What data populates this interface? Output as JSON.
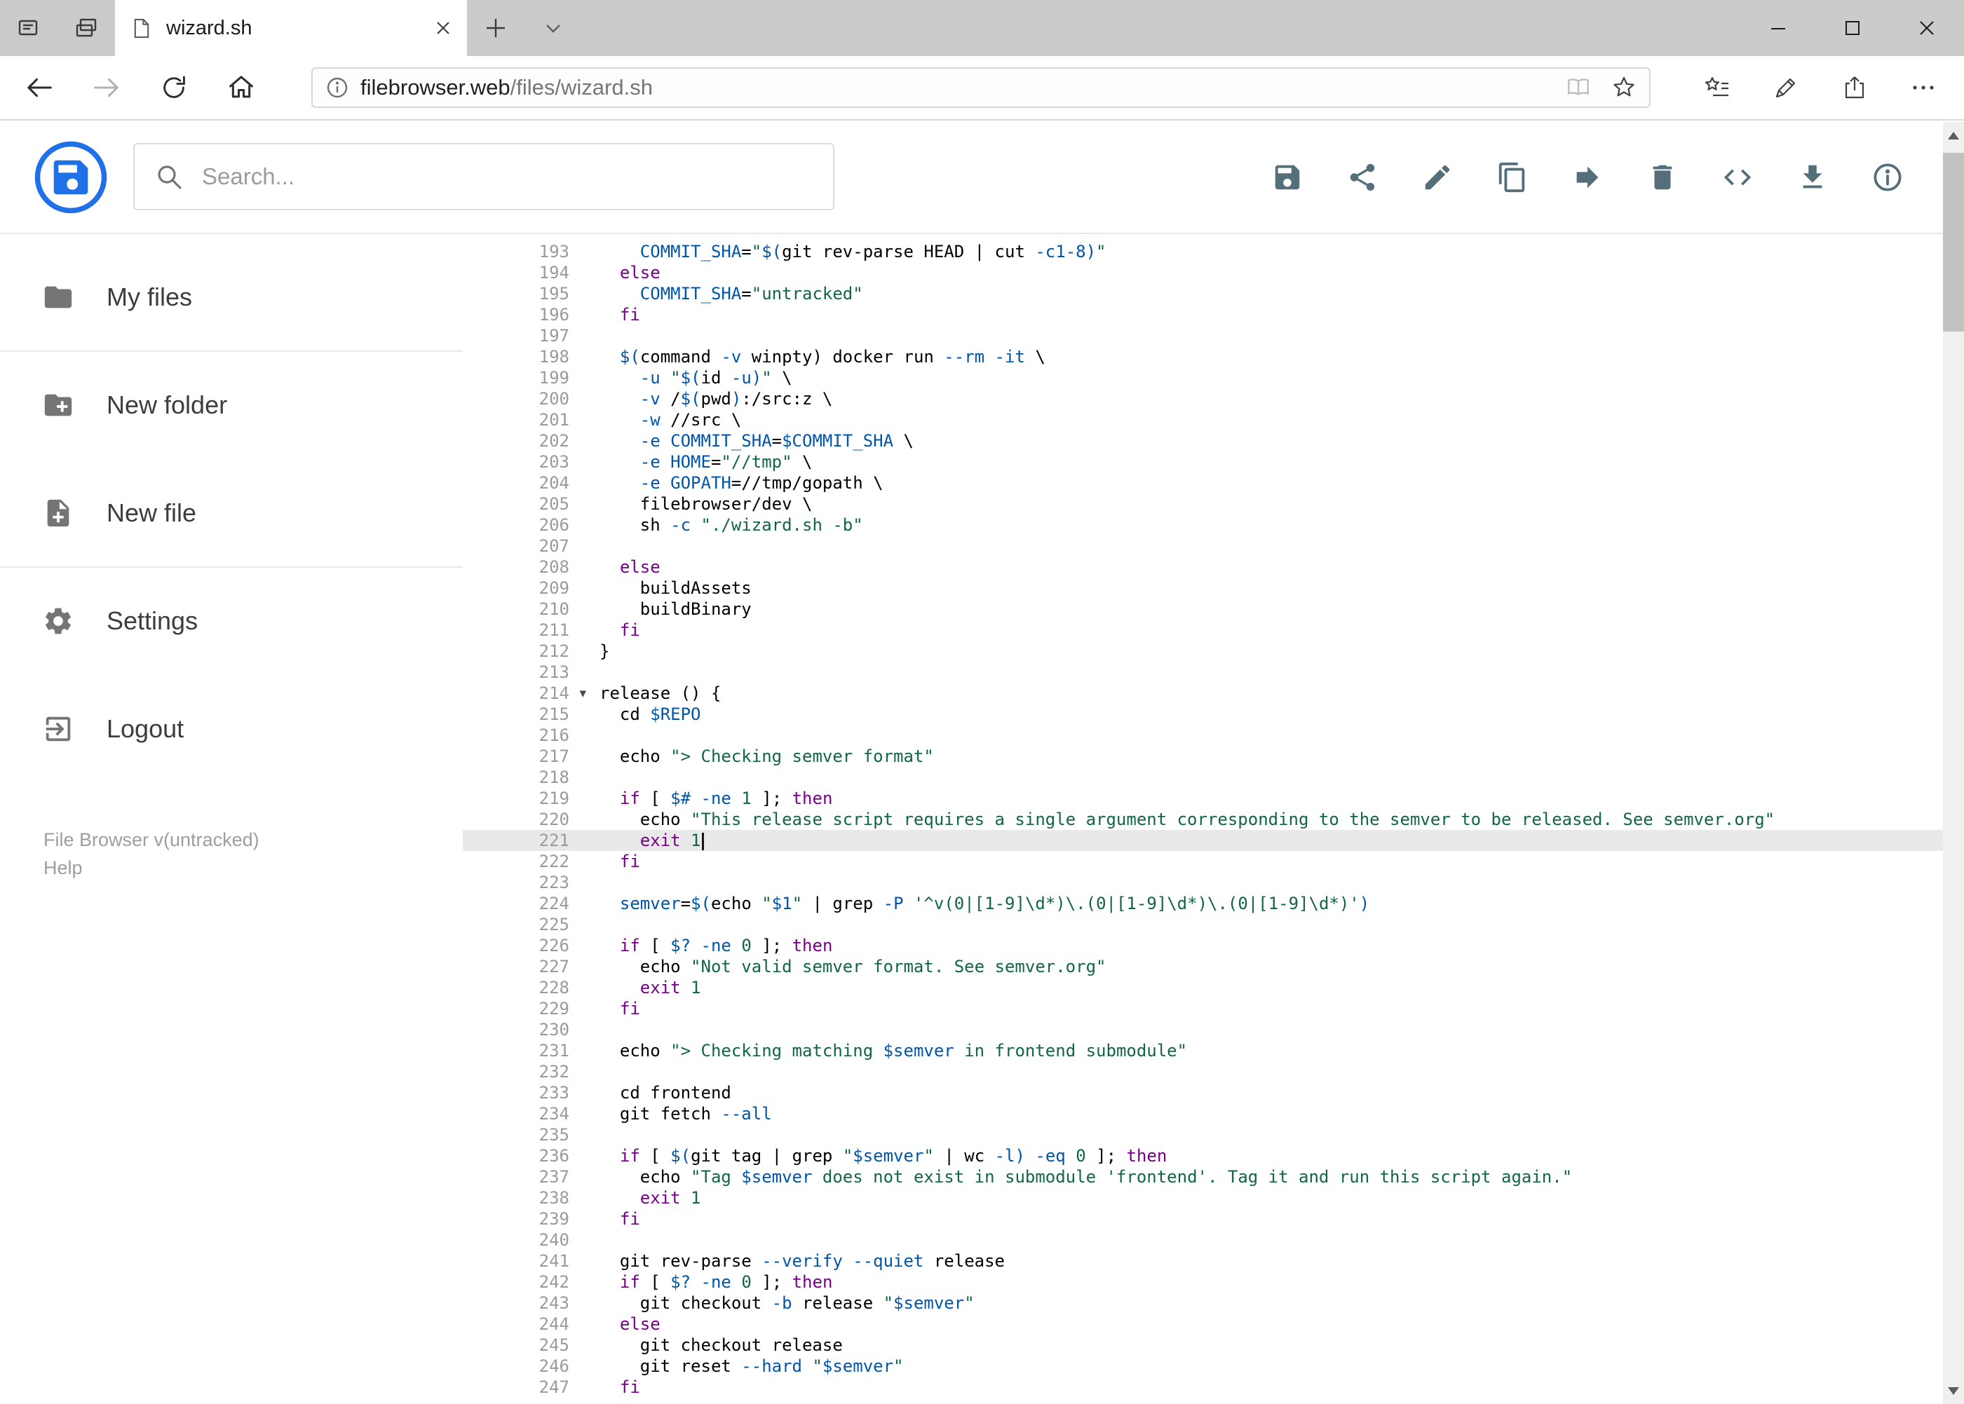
{
  "browser": {
    "tab_title": "wizard.sh",
    "url": {
      "domain": "filebrowser.web",
      "path": "/files/wizard.sh"
    }
  },
  "app": {
    "search_placeholder": "Search...",
    "toolbar_icons": [
      "save-icon",
      "share-icon",
      "edit-icon",
      "copy-icon",
      "move-icon",
      "delete-icon",
      "code-icon",
      "download-icon",
      "info-icon"
    ],
    "sidebar": {
      "items": [
        {
          "label": "My files",
          "icon": "folder-icon"
        },
        {
          "label": "New folder",
          "icon": "create-folder-icon"
        },
        {
          "label": "New file",
          "icon": "new-file-icon"
        },
        {
          "label": "Settings",
          "icon": "settings-gear-icon"
        },
        {
          "label": "Logout",
          "icon": "logout-icon"
        }
      ],
      "version": "File Browser v(untracked)",
      "help": "Help"
    }
  },
  "colors": {
    "brand_blue": "#2071e7",
    "toolbar_icon": "#546e7a",
    "active_line_bg": "#e9e9e9",
    "syntax_keyword": "#770088",
    "syntax_variable": "#0055aa",
    "syntax_string": "#116644"
  },
  "editor": {
    "active_line": 221,
    "cursor_line": 221,
    "fold_markers": [
      214
    ],
    "lines": [
      {
        "n": 193,
        "segs": [
          [
            "    ",
            "p"
          ],
          [
            "COMMIT_SHA",
            "def"
          ],
          [
            "=",
            "p"
          ],
          [
            "\"",
            "str"
          ],
          [
            "$(",
            "var"
          ],
          [
            "git rev-parse HEAD | cut ",
            "p"
          ],
          [
            "-c1-8",
            "attr"
          ],
          [
            ")",
            "var"
          ],
          [
            "\"",
            "str"
          ]
        ]
      },
      {
        "n": 194,
        "segs": [
          [
            "  ",
            "p"
          ],
          [
            "else",
            "kw"
          ]
        ]
      },
      {
        "n": 195,
        "segs": [
          [
            "    ",
            "p"
          ],
          [
            "COMMIT_SHA",
            "def"
          ],
          [
            "=",
            "p"
          ],
          [
            "\"untracked\"",
            "str"
          ]
        ]
      },
      {
        "n": 196,
        "segs": [
          [
            "  ",
            "p"
          ],
          [
            "fi",
            "kw"
          ]
        ]
      },
      {
        "n": 197,
        "segs": []
      },
      {
        "n": 198,
        "segs": [
          [
            "  ",
            "p"
          ],
          [
            "$(",
            "var"
          ],
          [
            "command ",
            "p"
          ],
          [
            "-v",
            "attr"
          ],
          [
            " winpty) docker run ",
            "p"
          ],
          [
            "--rm",
            "attr"
          ],
          [
            " ",
            "p"
          ],
          [
            "-it",
            "attr"
          ],
          [
            " \\",
            "p"
          ]
        ]
      },
      {
        "n": 199,
        "segs": [
          [
            "    ",
            "p"
          ],
          [
            "-u",
            "attr"
          ],
          [
            " ",
            "p"
          ],
          [
            "\"",
            "str"
          ],
          [
            "$(",
            "var"
          ],
          [
            "id ",
            "p"
          ],
          [
            "-u",
            "attr"
          ],
          [
            ")",
            "var"
          ],
          [
            "\"",
            "str"
          ],
          [
            " \\",
            "p"
          ]
        ]
      },
      {
        "n": 200,
        "segs": [
          [
            "    ",
            "p"
          ],
          [
            "-v",
            "attr"
          ],
          [
            " /",
            "p"
          ],
          [
            "$(",
            "var"
          ],
          [
            "pwd",
            "p"
          ],
          [
            ")",
            "var"
          ],
          [
            ":/src:z \\",
            "p"
          ]
        ]
      },
      {
        "n": 201,
        "segs": [
          [
            "    ",
            "p"
          ],
          [
            "-w",
            "attr"
          ],
          [
            " //src \\",
            "p"
          ]
        ]
      },
      {
        "n": 202,
        "segs": [
          [
            "    ",
            "p"
          ],
          [
            "-e",
            "attr"
          ],
          [
            " ",
            "p"
          ],
          [
            "COMMIT_SHA",
            "def"
          ],
          [
            "=",
            "p"
          ],
          [
            "$COMMIT_SHA",
            "var"
          ],
          [
            " \\",
            "p"
          ]
        ]
      },
      {
        "n": 203,
        "segs": [
          [
            "    ",
            "p"
          ],
          [
            "-e",
            "attr"
          ],
          [
            " ",
            "p"
          ],
          [
            "HOME",
            "def"
          ],
          [
            "=",
            "p"
          ],
          [
            "\"//tmp\"",
            "str"
          ],
          [
            " \\",
            "p"
          ]
        ]
      },
      {
        "n": 204,
        "segs": [
          [
            "    ",
            "p"
          ],
          [
            "-e",
            "attr"
          ],
          [
            " ",
            "p"
          ],
          [
            "GOPATH",
            "def"
          ],
          [
            "=",
            "p"
          ],
          [
            "//tmp/gopath \\",
            "p"
          ]
        ]
      },
      {
        "n": 205,
        "segs": [
          [
            "    filebrowser/dev \\",
            "p"
          ]
        ]
      },
      {
        "n": 206,
        "segs": [
          [
            "    sh ",
            "p"
          ],
          [
            "-c",
            "attr"
          ],
          [
            " ",
            "p"
          ],
          [
            "\"./wizard.sh -b\"",
            "str"
          ]
        ]
      },
      {
        "n": 207,
        "segs": []
      },
      {
        "n": 208,
        "segs": [
          [
            "  ",
            "p"
          ],
          [
            "else",
            "kw"
          ]
        ]
      },
      {
        "n": 209,
        "segs": [
          [
            "    buildAssets",
            "p"
          ]
        ]
      },
      {
        "n": 210,
        "segs": [
          [
            "    buildBinary",
            "p"
          ]
        ]
      },
      {
        "n": 211,
        "segs": [
          [
            "  ",
            "p"
          ],
          [
            "fi",
            "kw"
          ]
        ]
      },
      {
        "n": 212,
        "segs": [
          [
            "}",
            "p"
          ]
        ]
      },
      {
        "n": 213,
        "segs": []
      },
      {
        "n": 214,
        "segs": [
          [
            "release () {",
            "p"
          ]
        ]
      },
      {
        "n": 215,
        "segs": [
          [
            "  cd ",
            "p"
          ],
          [
            "$REPO",
            "var"
          ]
        ]
      },
      {
        "n": 216,
        "segs": []
      },
      {
        "n": 217,
        "segs": [
          [
            "  echo ",
            "p"
          ],
          [
            "\"> Checking semver format\"",
            "str"
          ]
        ]
      },
      {
        "n": 218,
        "segs": []
      },
      {
        "n": 219,
        "segs": [
          [
            "  ",
            "p"
          ],
          [
            "if",
            "kw"
          ],
          [
            " [ ",
            "p"
          ],
          [
            "$#",
            "var"
          ],
          [
            " ",
            "p"
          ],
          [
            "-ne",
            "attr"
          ],
          [
            " ",
            "p"
          ],
          [
            "1",
            "num"
          ],
          [
            " ]; ",
            "p"
          ],
          [
            "then",
            "kw"
          ]
        ]
      },
      {
        "n": 220,
        "segs": [
          [
            "    echo ",
            "p"
          ],
          [
            "\"This release script requires a single argument corresponding to the semver to be released. See semver.org\"",
            "str"
          ]
        ]
      },
      {
        "n": 221,
        "segs": [
          [
            "    ",
            "p"
          ],
          [
            "exit",
            "kw"
          ],
          [
            " ",
            "p"
          ],
          [
            "1",
            "num"
          ]
        ]
      },
      {
        "n": 222,
        "segs": [
          [
            "  ",
            "p"
          ],
          [
            "fi",
            "kw"
          ]
        ]
      },
      {
        "n": 223,
        "segs": []
      },
      {
        "n": 224,
        "segs": [
          [
            "  ",
            "p"
          ],
          [
            "semver",
            "def"
          ],
          [
            "=",
            "p"
          ],
          [
            "$(",
            "var"
          ],
          [
            "echo ",
            "p"
          ],
          [
            "\"",
            "str"
          ],
          [
            "$1",
            "var"
          ],
          [
            "\"",
            "str"
          ],
          [
            " | grep ",
            "p"
          ],
          [
            "-P",
            "attr"
          ],
          [
            " ",
            "p"
          ],
          [
            "'^v(0|[1-9]\\d*)\\.(0|[1-9]\\d*)\\.(0|[1-9]\\d*)'",
            "str"
          ],
          [
            ")",
            "var"
          ]
        ]
      },
      {
        "n": 225,
        "segs": []
      },
      {
        "n": 226,
        "segs": [
          [
            "  ",
            "p"
          ],
          [
            "if",
            "kw"
          ],
          [
            " [ ",
            "p"
          ],
          [
            "$?",
            "var"
          ],
          [
            " ",
            "p"
          ],
          [
            "-ne",
            "attr"
          ],
          [
            " ",
            "p"
          ],
          [
            "0",
            "num"
          ],
          [
            " ]; ",
            "p"
          ],
          [
            "then",
            "kw"
          ]
        ]
      },
      {
        "n": 227,
        "segs": [
          [
            "    echo ",
            "p"
          ],
          [
            "\"Not valid semver format. See semver.org\"",
            "str"
          ]
        ]
      },
      {
        "n": 228,
        "segs": [
          [
            "    ",
            "p"
          ],
          [
            "exit",
            "kw"
          ],
          [
            " ",
            "p"
          ],
          [
            "1",
            "num"
          ]
        ]
      },
      {
        "n": 229,
        "segs": [
          [
            "  ",
            "p"
          ],
          [
            "fi",
            "kw"
          ]
        ]
      },
      {
        "n": 230,
        "segs": []
      },
      {
        "n": 231,
        "segs": [
          [
            "  echo ",
            "p"
          ],
          [
            "\"> Checking matching ",
            "str"
          ],
          [
            "$semver",
            "var"
          ],
          [
            " in frontend submodule\"",
            "str"
          ]
        ]
      },
      {
        "n": 232,
        "segs": []
      },
      {
        "n": 233,
        "segs": [
          [
            "  cd frontend",
            "p"
          ]
        ]
      },
      {
        "n": 234,
        "segs": [
          [
            "  git fetch ",
            "p"
          ],
          [
            "--all",
            "attr"
          ]
        ]
      },
      {
        "n": 235,
        "segs": []
      },
      {
        "n": 236,
        "segs": [
          [
            "  ",
            "p"
          ],
          [
            "if",
            "kw"
          ],
          [
            " [ ",
            "p"
          ],
          [
            "$(",
            "var"
          ],
          [
            "git tag | grep ",
            "p"
          ],
          [
            "\"",
            "str"
          ],
          [
            "$semver",
            "var"
          ],
          [
            "\"",
            "str"
          ],
          [
            " | wc ",
            "p"
          ],
          [
            "-l",
            "attr"
          ],
          [
            ")",
            "var"
          ],
          [
            " ",
            "p"
          ],
          [
            "-eq",
            "attr"
          ],
          [
            " ",
            "p"
          ],
          [
            "0",
            "num"
          ],
          [
            " ]; ",
            "p"
          ],
          [
            "then",
            "kw"
          ]
        ]
      },
      {
        "n": 237,
        "segs": [
          [
            "    echo ",
            "p"
          ],
          [
            "\"Tag ",
            "str"
          ],
          [
            "$semver",
            "var"
          ],
          [
            " does not exist in submodule 'frontend'. Tag it and run this script again.\"",
            "str"
          ]
        ]
      },
      {
        "n": 238,
        "segs": [
          [
            "    ",
            "p"
          ],
          [
            "exit",
            "kw"
          ],
          [
            " ",
            "p"
          ],
          [
            "1",
            "num"
          ]
        ]
      },
      {
        "n": 239,
        "segs": [
          [
            "  ",
            "p"
          ],
          [
            "fi",
            "kw"
          ]
        ]
      },
      {
        "n": 240,
        "segs": []
      },
      {
        "n": 241,
        "segs": [
          [
            "  git rev-parse ",
            "p"
          ],
          [
            "--verify",
            "attr"
          ],
          [
            " ",
            "p"
          ],
          [
            "--quiet",
            "attr"
          ],
          [
            " release",
            "p"
          ]
        ]
      },
      {
        "n": 242,
        "segs": [
          [
            "  ",
            "p"
          ],
          [
            "if",
            "kw"
          ],
          [
            " [ ",
            "p"
          ],
          [
            "$?",
            "var"
          ],
          [
            " ",
            "p"
          ],
          [
            "-ne",
            "attr"
          ],
          [
            " ",
            "p"
          ],
          [
            "0",
            "num"
          ],
          [
            " ]; ",
            "p"
          ],
          [
            "then",
            "kw"
          ]
        ]
      },
      {
        "n": 243,
        "segs": [
          [
            "    git checkout ",
            "p"
          ],
          [
            "-b",
            "attr"
          ],
          [
            " release ",
            "p"
          ],
          [
            "\"",
            "str"
          ],
          [
            "$semver",
            "var"
          ],
          [
            "\"",
            "str"
          ]
        ]
      },
      {
        "n": 244,
        "segs": [
          [
            "  ",
            "p"
          ],
          [
            "else",
            "kw"
          ]
        ]
      },
      {
        "n": 245,
        "segs": [
          [
            "    git checkout release",
            "p"
          ]
        ]
      },
      {
        "n": 246,
        "segs": [
          [
            "    git reset ",
            "p"
          ],
          [
            "--hard",
            "attr"
          ],
          [
            " ",
            "p"
          ],
          [
            "\"",
            "str"
          ],
          [
            "$semver",
            "var"
          ],
          [
            "\"",
            "str"
          ]
        ]
      },
      {
        "n": 247,
        "segs": [
          [
            "  ",
            "p"
          ],
          [
            "fi",
            "kw"
          ]
        ]
      }
    ]
  }
}
